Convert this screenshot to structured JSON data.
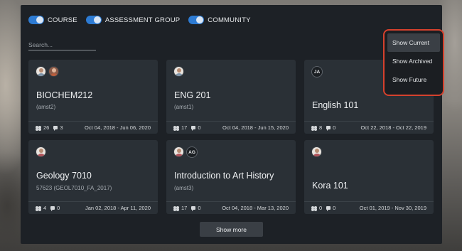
{
  "filters": [
    {
      "label": "COURSE",
      "on": true
    },
    {
      "label": "ASSESSMENT GROUP",
      "on": true
    },
    {
      "label": "COMMUNITY",
      "on": true
    }
  ],
  "search": {
    "placeholder": "Search..."
  },
  "menu": {
    "items": [
      "Show Current",
      "Show Archived",
      "Show Future"
    ],
    "selected": "Show Current",
    "highlight_color": "#d5412d"
  },
  "cards": [
    {
      "title": "BIOCHEM212",
      "subtitle": "(amst2)",
      "members": "26",
      "comments": "3",
      "dates": "Oct 04, 2018 - Jun 06, 2020",
      "avatars": [
        "user-photo",
        "user-photo-female"
      ]
    },
    {
      "title": "ENG 201",
      "subtitle": "(amst1)",
      "members": "17",
      "comments": "0",
      "dates": "Oct 04, 2018 - Jun 15, 2020",
      "avatars": [
        "user-photo"
      ]
    },
    {
      "title": "English 101",
      "subtitle": "",
      "members": "8",
      "comments": "0",
      "dates": "Oct 22, 2018 - Oct 22, 2019",
      "avatars": [],
      "initials": [
        "JA"
      ]
    },
    {
      "title": "Geology 7010",
      "subtitle": "57623 (GEOL7010_FA_2017)",
      "members": "4",
      "comments": "0",
      "dates": "Jan 02, 2018 - Apr 11, 2020",
      "avatars": [
        "user-photo-red"
      ]
    },
    {
      "title": "Introduction to Art History",
      "subtitle": "(amst3)",
      "members": "17",
      "comments": "0",
      "dates": "Oct 04, 2018 - Mar 13, 2020",
      "avatars": [
        "user-photo-red"
      ],
      "initials": [
        "AG"
      ]
    },
    {
      "title": "Kora 101",
      "subtitle": "",
      "members": "0",
      "comments": "0",
      "dates": "Oct 01, 2019 - Nov 30, 2019",
      "avatars": [
        "user-photo-red"
      ]
    }
  ],
  "show_more_label": "Show more",
  "colors": {
    "accent": "#2d7bd3",
    "panel": "#1d2126",
    "card": "#2a3036"
  }
}
